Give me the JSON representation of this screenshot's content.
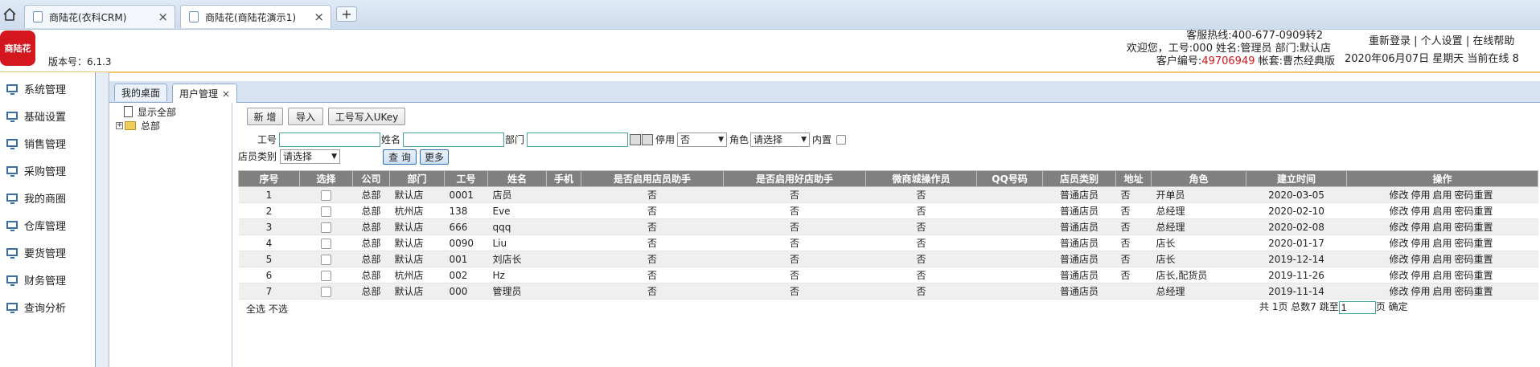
{
  "browser": {
    "tabs": [
      {
        "title": "商陆花(衣科CRM)",
        "active": false
      },
      {
        "title": "商陆花(商陆花演示1)",
        "active": true
      }
    ],
    "new_tab": "+",
    "close": "×"
  },
  "header": {
    "logo_text": "商陆花",
    "version": "版本号：6.1.3",
    "hotline": "客服热线:400-677-0909转2",
    "welcome": "欢迎您，工号:000 姓名:管理员 部门:默认店",
    "customer_label": "客户编号:",
    "customer_no": "49706949",
    "account": " 帐套:曹杰经典版",
    "links": [
      "重新登录",
      "个人设置",
      "在线帮助"
    ],
    "link_sep": " | ",
    "date": "2020年06月07日 星期天 当前在线 8"
  },
  "sidebar": {
    "items": [
      "系统管理",
      "基础设置",
      "销售管理",
      "采购管理",
      "我的商圈",
      "仓库管理",
      "要货管理",
      "财务管理",
      "查询分析"
    ]
  },
  "content_tabs": [
    {
      "label": "我的桌面",
      "active": false
    },
    {
      "label": "用户管理",
      "active": true,
      "close": "×"
    }
  ],
  "tree": {
    "show_all": "显示全部",
    "root": "总部"
  },
  "toolbar": {
    "new_label": "新 增",
    "import_label": "导入",
    "ukey_label": "工号写入UKey"
  },
  "filters": {
    "emp_no_label": "工号",
    "name_label": "姓名",
    "dept_label": "部门",
    "disabled_label": "停用",
    "disabled_value": "否",
    "role_label": "角色",
    "role_value": "请选择",
    "builtin_label": "内置",
    "staff_type_label": "店员类别",
    "staff_type_value": "请选择",
    "query_label": "查 询",
    "more_label": "更多"
  },
  "table": {
    "columns": [
      "序号",
      "选择",
      "公司",
      "部门",
      "工号",
      "姓名",
      "手机",
      "是否启用店员助手",
      "是否启用好店助手",
      "微商城操作员",
      "QQ号码",
      "店员类别",
      "地址",
      "角色",
      "建立时间",
      "操作"
    ],
    "rows": [
      {
        "no": "1",
        "company": "总部",
        "dept": "默认店",
        "emp_no": "0001",
        "name": "店员",
        "phone": "",
        "clerk_assist": "否",
        "shop_assist": "否",
        "wechat_op": "否",
        "qq": "",
        "staff_type": "普通店员",
        "addr": "否",
        "role": "开单员",
        "created": "2020-03-05"
      },
      {
        "no": "2",
        "company": "总部",
        "dept": "杭州店",
        "emp_no": "138",
        "name": "Eve",
        "phone": "",
        "clerk_assist": "否",
        "shop_assist": "否",
        "wechat_op": "否",
        "qq": "",
        "staff_type": "普通店员",
        "addr": "否",
        "role": "总经理",
        "created": "2020-02-10"
      },
      {
        "no": "3",
        "company": "总部",
        "dept": "默认店",
        "emp_no": "666",
        "name": "qqq",
        "phone": "",
        "clerk_assist": "否",
        "shop_assist": "否",
        "wechat_op": "否",
        "qq": "",
        "staff_type": "普通店员",
        "addr": "否",
        "role": "总经理",
        "created": "2020-02-08"
      },
      {
        "no": "4",
        "company": "总部",
        "dept": "默认店",
        "emp_no": "0090",
        "name": "Liu",
        "phone": "",
        "clerk_assist": "否",
        "shop_assist": "否",
        "wechat_op": "否",
        "qq": "",
        "staff_type": "普通店员",
        "addr": "否",
        "role": "店长",
        "created": "2020-01-17"
      },
      {
        "no": "5",
        "company": "总部",
        "dept": "默认店",
        "emp_no": "001",
        "name": "刘店长",
        "phone": "",
        "clerk_assist": "否",
        "shop_assist": "否",
        "wechat_op": "否",
        "qq": "",
        "staff_type": "普通店员",
        "addr": "否",
        "role": "店长",
        "created": "2019-12-14"
      },
      {
        "no": "6",
        "company": "总部",
        "dept": "杭州店",
        "emp_no": "002",
        "name": "Hz",
        "phone": "",
        "clerk_assist": "否",
        "shop_assist": "否",
        "wechat_op": "否",
        "qq": "",
        "staff_type": "普通店员",
        "addr": "否",
        "role": "店长,配货员",
        "created": "2019-11-26"
      },
      {
        "no": "7",
        "company": "总部",
        "dept": "默认店",
        "emp_no": "000",
        "name": "管理员",
        "phone": "",
        "clerk_assist": "否",
        "shop_assist": "否",
        "wechat_op": "否",
        "qq": "",
        "staff_type": "普通店员",
        "addr": "",
        "role": "总经理",
        "created": "2019-11-14"
      }
    ],
    "ops": [
      "修改",
      "停用",
      "启用",
      "密码重置"
    ]
  },
  "footer": {
    "select_all": "全选",
    "select_none": "不选",
    "pages_label": "共 1页 总数7 跳至",
    "page_value": "1",
    "page_suffix": "页",
    "confirm": "确定"
  },
  "colors": {
    "grid_header": "#808080",
    "accent_border": "#f0c46c",
    "logo": "#d4161e"
  }
}
